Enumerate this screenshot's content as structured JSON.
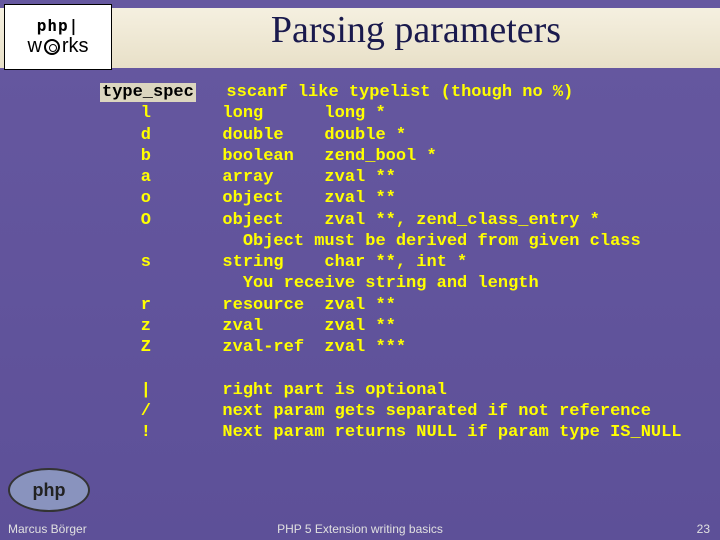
{
  "brand": {
    "top": "php|",
    "bottom_left": "w",
    "bottom_right": "rks"
  },
  "title": "Parsing parameters",
  "body": "type_spec   sscanf like typelist (though no %)\n    l       long      long *\n    d       double    double *\n    b       boolean   zend_bool *\n    a       array     zval **\n    o       object    zval **\n    O       object    zval **, zend_class_entry *\n              Object must be derived from given class\n    s       string    char **, int *\n              You receive string and length\n    r       resource  zval **\n    z       zval      zval **\n    Z       zval-ref  zval ***\n\n    |       right part is optional\n    /       next param gets separated if not reference\n    !       Next param returns NULL if param type IS_NULL",
  "php_logo": "php",
  "footer": {
    "left": "Marcus Börger",
    "mid": "PHP 5 Extension writing basics",
    "right": "23"
  }
}
